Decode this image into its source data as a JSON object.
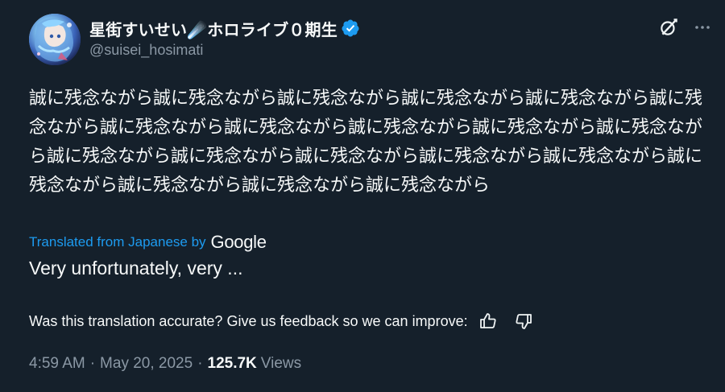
{
  "author": {
    "display_name": "星街すいせい☄️ホロライブ０期生",
    "handle": "@suisei_hosimati",
    "verified": true,
    "avatar_icon": "avatar-image"
  },
  "actions": {
    "grok_icon": "grok-icon",
    "more_icon": "more-icon"
  },
  "tweet": {
    "text": "誠に残念ながら誠に残念ながら誠に残念ながら誠に残念ながら誠に残念ながら誠に残念ながら誠に残念ながら誠に残念ながら誠に残念ながら誠に残念ながら誠に残念ながら誠に残念ながら誠に残念ながら誠に残念ながら誠に残念ながら誠に残念ながら誠に残念ながら誠に残念ながら誠に残念ながら誠に残念ながら"
  },
  "translation": {
    "link_label": "Translated from Japanese by",
    "provider": "Google",
    "text": "Very unfortunately, very ..."
  },
  "feedback": {
    "prompt": "Was this translation accurate? Give us feedback so we can improve:",
    "thumbs_up_icon": "thumbs-up-icon",
    "thumbs_down_icon": "thumbs-down-icon"
  },
  "meta": {
    "time": "4:59 AM",
    "separator": "·",
    "date": "May 20, 2025",
    "views_count": "125.7K",
    "views_label": "Views"
  },
  "colors": {
    "background": "#15202b",
    "text": "#f7f9f9",
    "muted": "#8b98a5",
    "link": "#1d9bf0"
  }
}
